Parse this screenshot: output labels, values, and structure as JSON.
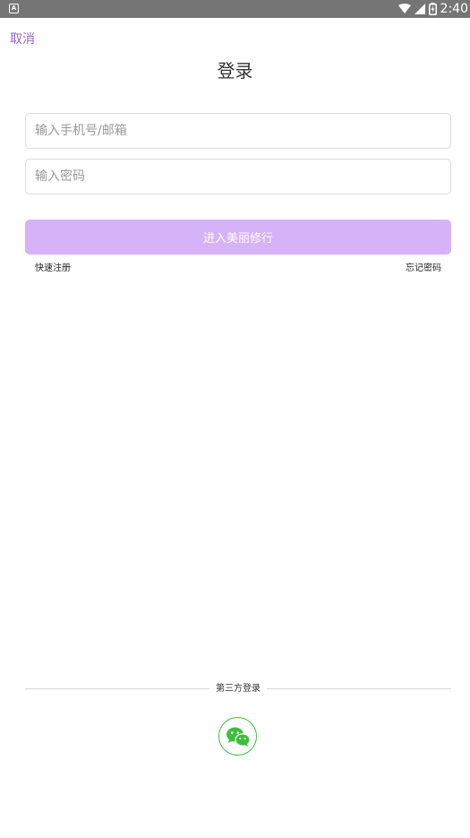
{
  "status_bar": {
    "notification_icon": "a-badge-icon",
    "time": "2:40",
    "icons": [
      "wifi-icon",
      "cell-signal-icon",
      "battery-charging-icon"
    ]
  },
  "header": {
    "cancel_label": "取消",
    "title": "登录"
  },
  "form": {
    "phone_placeholder": "输入手机号/邮箱",
    "phone_value": "",
    "password_placeholder": "输入密码",
    "password_value": "",
    "submit_label": "进入美丽修行"
  },
  "links": {
    "register": "快速注册",
    "forgot": "忘记密码"
  },
  "third_party": {
    "label": "第三方登录",
    "providers": [
      "wechat-icon"
    ]
  },
  "colors": {
    "accent": "#9b5fd0",
    "button_disabled": "#d6b2f8",
    "wechat_green": "#3bbf3b"
  }
}
